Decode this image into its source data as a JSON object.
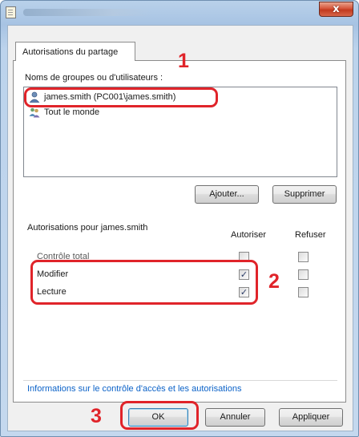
{
  "window": {
    "close_symbol": "x",
    "accent_close": "#c23a1f"
  },
  "tab": {
    "label": "Autorisations du partage"
  },
  "users": {
    "heading": "Noms de groupes ou d'utilisateurs :",
    "items": [
      {
        "label": "james.smith (PC001\\james.smith)",
        "icon": "user-icon",
        "selected": true
      },
      {
        "label": "Tout le monde",
        "icon": "users-group-icon",
        "selected": false
      }
    ],
    "add_button": "Ajouter...",
    "remove_button": "Supprimer"
  },
  "permissions": {
    "heading": "Autorisations pour james.smith",
    "col_allow": "Autoriser",
    "col_deny": "Refuser",
    "rows": [
      {
        "label": "Contrôle total",
        "allow": false,
        "deny": false
      },
      {
        "label": "Modifier",
        "allow": true,
        "deny": false
      },
      {
        "label": "Lecture",
        "allow": true,
        "deny": false
      }
    ]
  },
  "info_link": "Informations sur le contrôle d'accès et les autorisations",
  "footer": {
    "ok_button": "OK",
    "cancel_button": "Annuler",
    "apply_button": "Appliquer"
  },
  "annotations": {
    "step1": "1",
    "step2": "2",
    "step3": "3",
    "color": "#e0242a"
  },
  "checkmark": "✓"
}
